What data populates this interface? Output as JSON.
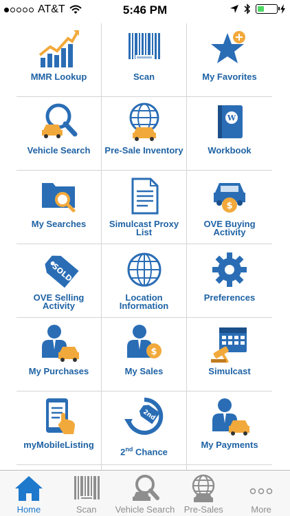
{
  "status_bar": {
    "carrier": "AT&T",
    "time": "5:46 PM",
    "signal_bars_filled": 1,
    "signal_bars_total": 5,
    "battery_level": 0.35
  },
  "menu": {
    "items": [
      {
        "label": "MMR Lookup",
        "icon": "trend-chart-icon"
      },
      {
        "label": "Scan",
        "icon": "barcode-icon"
      },
      {
        "label": "My Favorites",
        "icon": "favorite-star-icon"
      },
      {
        "label": "Vehicle Search",
        "icon": "car-search-icon"
      },
      {
        "label": "Pre-Sale Inventory",
        "icon": "globe-car-icon"
      },
      {
        "label": "Workbook",
        "icon": "workbook-icon"
      },
      {
        "label": "My Searches",
        "icon": "folder-search-icon"
      },
      {
        "label": "Simulcast Proxy List",
        "icon": "document-list-icon"
      },
      {
        "label": "OVE Buying Activity",
        "icon": "car-coin-icon"
      },
      {
        "label": "OVE Selling Activity",
        "icon": "sold-tag-icon"
      },
      {
        "label": "Location Information",
        "icon": "globe-icon"
      },
      {
        "label": "Preferences",
        "icon": "gear-icon"
      },
      {
        "label": "My Purchases",
        "icon": "user-car-icon"
      },
      {
        "label": "My Sales",
        "icon": "user-coin-icon"
      },
      {
        "label": "Simulcast",
        "icon": "calendar-gavel-icon"
      },
      {
        "label": "myMobileListing",
        "icon": "tablet-hand-icon"
      },
      {
        "label": "2nd Chance",
        "label_main": "2",
        "label_sup": "nd",
        "label_rest": " Chance",
        "icon": "second-chance-icon"
      },
      {
        "label": "My Payments",
        "icon": "user-car-payment-icon"
      }
    ]
  },
  "tab_bar": {
    "tabs": [
      {
        "label": "Home",
        "icon": "home-icon",
        "active": true
      },
      {
        "label": "Scan",
        "icon": "barcode-icon",
        "active": false
      },
      {
        "label": "Vehicle Search",
        "icon": "car-search-icon",
        "active": false
      },
      {
        "label": "Pre-Sales",
        "icon": "globe-car-icon",
        "active": false
      },
      {
        "label": "More",
        "icon": "more-dots-icon",
        "active": false
      }
    ]
  },
  "colors": {
    "accent": "#1e62a4",
    "icon_blue": "#2a6db5",
    "icon_orange": "#f2a93b",
    "tab_active": "#1e78cc",
    "tab_inactive": "#8e8e8e"
  }
}
